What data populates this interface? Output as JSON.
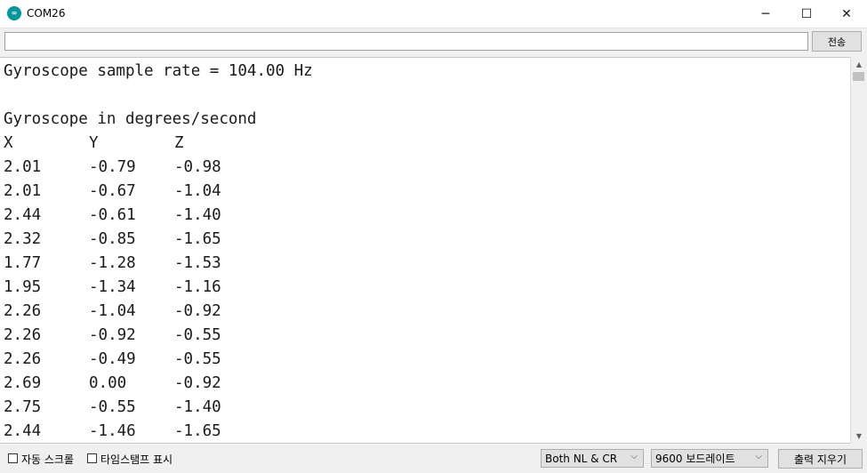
{
  "window": {
    "title": "COM26",
    "icon": "arduino-icon",
    "icon_glyph": "∞"
  },
  "controls": {
    "minimize": "─",
    "maximize": "☐",
    "close": "✕"
  },
  "send": {
    "input_value": "",
    "input_placeholder": "",
    "button_label": "전송"
  },
  "output": {
    "rate_line": "Gyroscope sample rate = 104.00 Hz",
    "heading": "Gyroscope in degrees/second",
    "headers": [
      "X",
      "Y",
      "Z"
    ],
    "rows": [
      [
        "2.01",
        "-0.79",
        "-0.98"
      ],
      [
        "2.01",
        "-0.67",
        "-1.04"
      ],
      [
        "2.44",
        "-0.61",
        "-1.40"
      ],
      [
        "2.32",
        "-0.85",
        "-1.65"
      ],
      [
        "1.77",
        "-1.28",
        "-1.53"
      ],
      [
        "1.95",
        "-1.34",
        "-1.16"
      ],
      [
        "2.26",
        "-1.04",
        "-0.92"
      ],
      [
        "2.26",
        "-0.92",
        "-0.55"
      ],
      [
        "2.26",
        "-0.49",
        "-0.55"
      ],
      [
        "2.69",
        "0.00",
        "-0.92"
      ],
      [
        "2.75",
        "-0.55",
        "-1.40"
      ],
      [
        "2.44",
        "-1.46",
        "-1.65"
      ]
    ]
  },
  "scrollbar": {
    "up": "▲",
    "down": "▼"
  },
  "bottom": {
    "autoscroll_label": "자동 스크롤",
    "autoscroll_checked": false,
    "timestamp_label": "타임스탬프 표시",
    "timestamp_checked": false,
    "line_ending": "Both NL & CR",
    "baud_rate": "9600 보드레이트",
    "dropdown_chevron": "⌵",
    "clear_label": "출력 지우기"
  },
  "colors": {
    "accent": "#00979c",
    "text": "#1a1a1a",
    "background": "#ffffff"
  }
}
